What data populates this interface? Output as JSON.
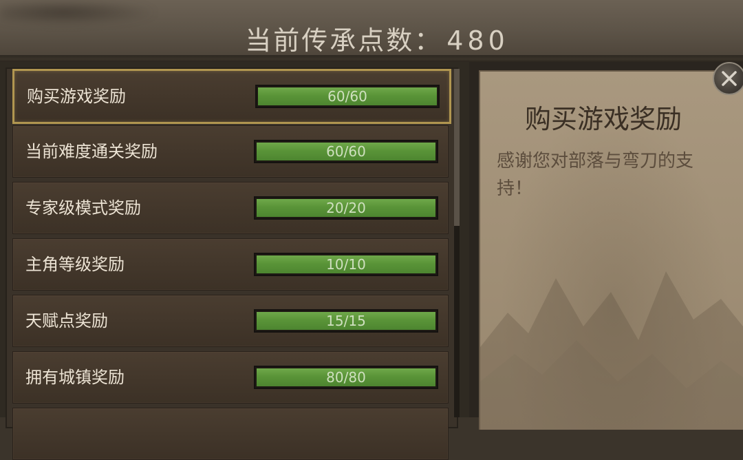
{
  "header": {
    "title_label": "当前传承点数：",
    "points": "480"
  },
  "rewards": [
    {
      "label": "购买游戏奖励",
      "progress_text": "60/60",
      "current": 60,
      "max": 60,
      "selected": true
    },
    {
      "label": "当前难度通关奖励",
      "progress_text": "60/60",
      "current": 60,
      "max": 60,
      "selected": false
    },
    {
      "label": "专家级模式奖励",
      "progress_text": "20/20",
      "current": 20,
      "max": 20,
      "selected": false
    },
    {
      "label": "主角等级奖励",
      "progress_text": "10/10",
      "current": 10,
      "max": 10,
      "selected": false
    },
    {
      "label": "天赋点奖励",
      "progress_text": "15/15",
      "current": 15,
      "max": 15,
      "selected": false
    },
    {
      "label": "拥有城镇奖励",
      "progress_text": "80/80",
      "current": 80,
      "max": 80,
      "selected": false
    }
  ],
  "detail": {
    "title": "购买游戏奖励",
    "description": "感谢您对部落与弯刀的支持！"
  },
  "colors": {
    "selected_border": "#b19650",
    "bar_green": "#5a9438",
    "parchment": "#a08f76"
  },
  "icons": {
    "close": "close-icon"
  }
}
